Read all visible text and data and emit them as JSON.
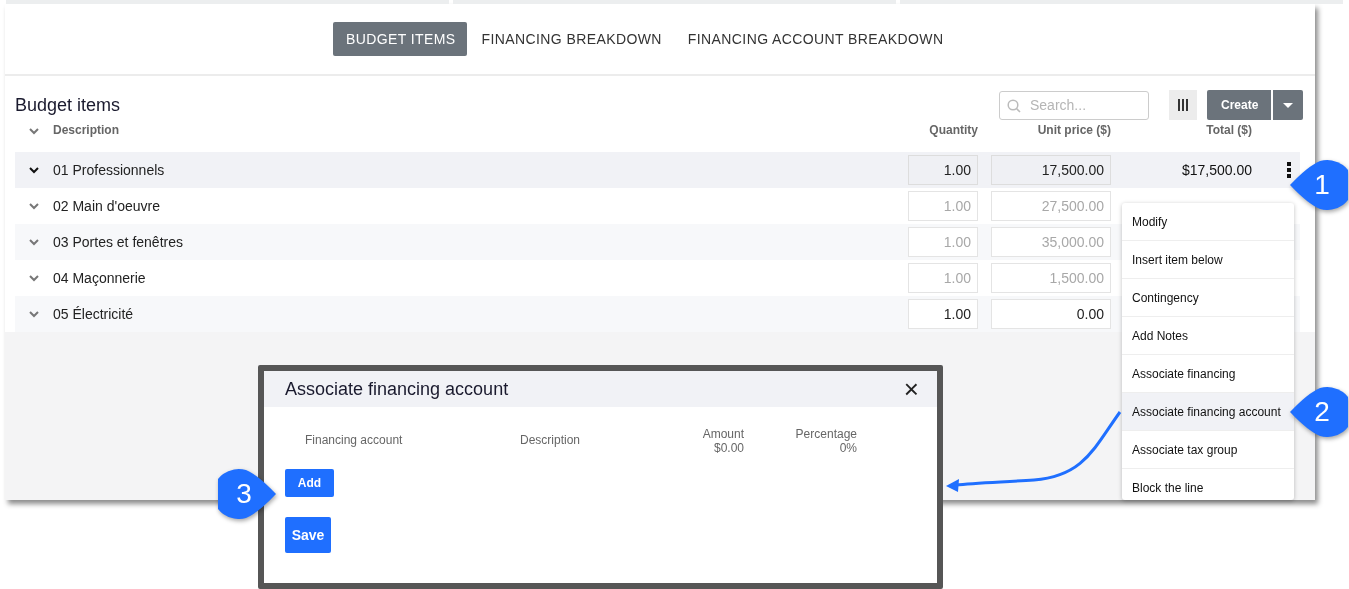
{
  "tabs": [
    {
      "label": "BUDGET ITEMS",
      "selected": true
    },
    {
      "label": "FINANCING BREAKDOWN",
      "selected": false
    },
    {
      "label": "FINANCING ACCOUNT BREAKDOWN",
      "selected": false
    }
  ],
  "section": {
    "title": "Budget items",
    "search": {
      "placeholder": "Search..."
    },
    "create_button": "Create"
  },
  "table": {
    "columns": [
      "Description",
      "Quantity",
      "Unit price ($)",
      "Total ($)"
    ],
    "rows": [
      {
        "description": "01 Professionnels",
        "quantity": "1.00",
        "unit_price": "17,500.00",
        "total": "$17,500.00",
        "selected": true,
        "disabled": false
      },
      {
        "description": "02 Main d'oeuvre",
        "quantity": "1.00",
        "unit_price": "27,500.00",
        "selected": false,
        "disabled": true
      },
      {
        "description": "03 Portes et fenêtres",
        "quantity": "1.00",
        "unit_price": "35,000.00",
        "selected": false,
        "disabled": true
      },
      {
        "description": "04 Maçonnerie",
        "quantity": "1.00",
        "unit_price": "1,500.00",
        "selected": false,
        "disabled": true
      },
      {
        "description": "05 Électricité",
        "quantity": "1.00",
        "unit_price": "0.00",
        "selected": false,
        "disabled": false
      }
    ]
  },
  "context_menu": {
    "items": [
      {
        "label": "Modify",
        "selected": false
      },
      {
        "label": "Insert item below",
        "selected": false
      },
      {
        "label": "Contingency",
        "selected": false
      },
      {
        "label": "Add Notes",
        "selected": false
      },
      {
        "label": "Associate financing",
        "selected": false
      },
      {
        "label": "Associate financing account",
        "selected": true
      },
      {
        "label": "Associate tax group",
        "selected": false
      },
      {
        "label": "Block the line",
        "selected": false
      }
    ]
  },
  "dialog": {
    "title": "Associate financing account",
    "close": "×",
    "columns": [
      {
        "label": "Financing account"
      },
      {
        "label": "Description"
      },
      {
        "label": "Amount",
        "total": "$0.00"
      },
      {
        "label": "Percentage",
        "total": "0%"
      }
    ],
    "add_button": "Add",
    "save_button": "Save"
  },
  "callouts": [
    {
      "number": "1",
      "kind": "left"
    },
    {
      "number": "2",
      "kind": "left"
    },
    {
      "number": "3",
      "kind": "right"
    }
  ]
}
